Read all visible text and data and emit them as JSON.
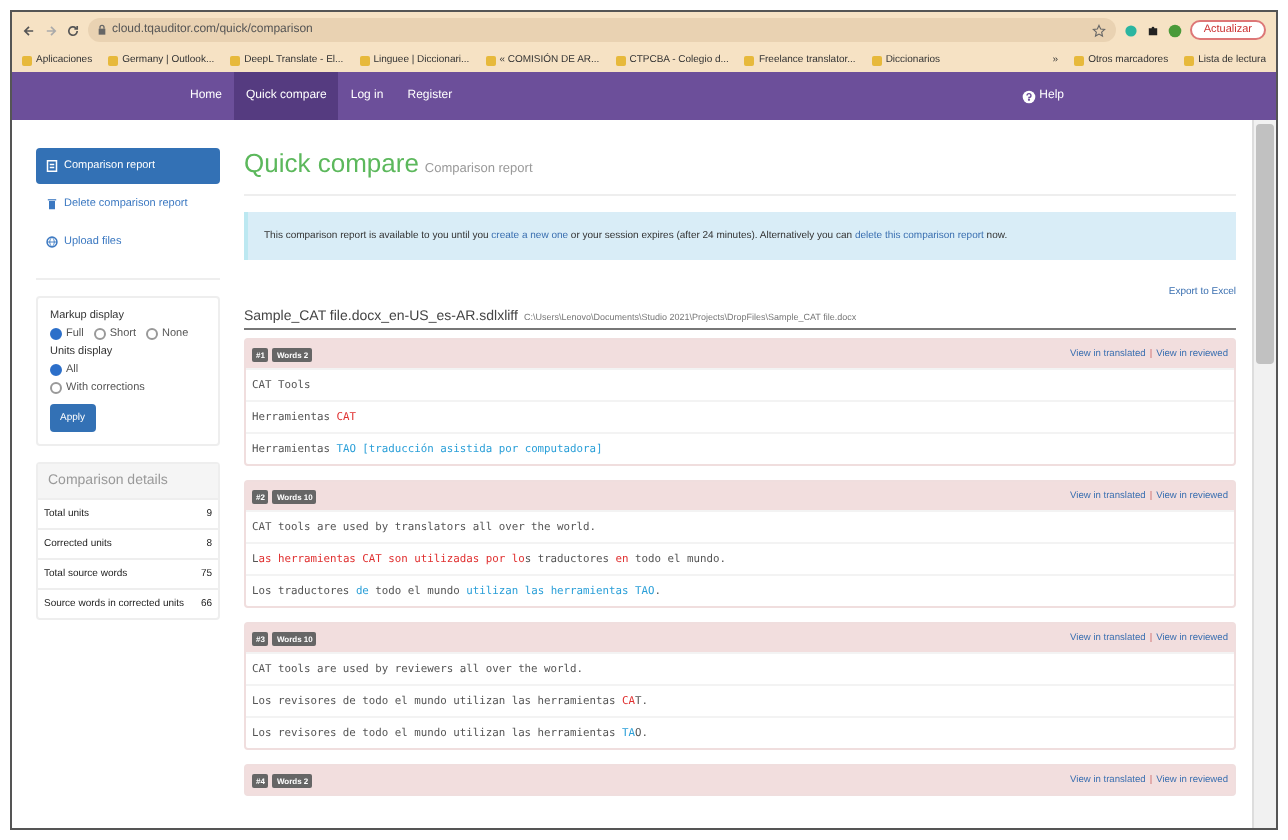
{
  "browser": {
    "url": "cloud.tqauditor.com/quick/comparison",
    "update_button": "Actualizar",
    "bookmarks": [
      "Aplicaciones",
      "Germany | Outlook...",
      "DeepL Translate - El...",
      "Linguee | Diccionari...",
      "« COMISIÓN DE AR...",
      "CTPCBA - Colegio d...",
      "Freelance translator...",
      "Diccionarios"
    ],
    "overflow": "»",
    "other_bookmarks": [
      "Otros marcadores",
      "Lista de lectura"
    ]
  },
  "nav": {
    "items": [
      {
        "label": "Home",
        "selected": false
      },
      {
        "label": "Quick compare",
        "selected": true
      },
      {
        "label": "Log in",
        "selected": false
      },
      {
        "label": "Register",
        "selected": false
      }
    ],
    "help": "Help"
  },
  "sidebar": {
    "items": [
      {
        "label": "Comparison report",
        "selected": true
      },
      {
        "label": "Delete comparison report",
        "selected": false
      },
      {
        "label": "Upload files",
        "selected": false
      }
    ],
    "markup_display": {
      "label": "Markup display",
      "options": [
        {
          "label": "Full",
          "selected": true
        },
        {
          "label": "Short",
          "selected": false
        },
        {
          "label": "None",
          "selected": false
        }
      ]
    },
    "units_display": {
      "label": "Units display",
      "options": [
        {
          "label": "All",
          "selected": true
        },
        {
          "label": "With corrections",
          "selected": false
        }
      ]
    },
    "apply": "Apply",
    "details": {
      "title": "Comparison details",
      "rows": [
        {
          "label": "Total units",
          "value": "9"
        },
        {
          "label": "Corrected units",
          "value": "8"
        },
        {
          "label": "Total source words",
          "value": "75"
        },
        {
          "label": "Source words in corrected units",
          "value": "66"
        }
      ]
    }
  },
  "heading": {
    "title": "Quick compare",
    "subtitle": "Comparison report"
  },
  "alert": [
    {
      "kind": "text",
      "text": "This comparison report is available to you until you "
    },
    {
      "kind": "link",
      "text": "create a new one"
    },
    {
      "kind": "text",
      "text": " or your session expires (after 24 minutes). Alternatively you can "
    },
    {
      "kind": "link",
      "text": "delete this comparison report"
    },
    {
      "kind": "text",
      "text": " now."
    }
  ],
  "export": "Export to Excel",
  "file": {
    "name": "Sample_CAT file.docx_en-US_es-AR.sdlxliff",
    "path": "C:\\Users\\Lenovo\\Documents\\Studio 2021\\Projects\\DropFiles\\Sample_CAT file.docx"
  },
  "units": [
    {
      "number": "#1",
      "words": "Words 2",
      "view_translated": "View in translated",
      "separator": "|",
      "view_reviewed": "View in reviewed",
      "lines": [
        [
          {
            "kind": "plain",
            "text": "CAT Tools"
          }
        ],
        [
          {
            "kind": "plain",
            "text": "Herramientas "
          },
          {
            "kind": "deleted",
            "text": "CAT"
          }
        ],
        [
          {
            "kind": "plain",
            "text": "Herramientas "
          },
          {
            "kind": "inserted",
            "text": "TAO [traducción asistida por computadora]"
          }
        ]
      ]
    },
    {
      "number": "#2",
      "words": "Words 10",
      "view_translated": "View in translated",
      "separator": "|",
      "view_reviewed": "View in reviewed",
      "lines": [
        [
          {
            "kind": "plain",
            "text": "CAT tools are used by translators all over the world."
          }
        ],
        [
          {
            "kind": "plain",
            "text": "L"
          },
          {
            "kind": "deleted",
            "text": "as herramientas CAT son utilizadas por lo"
          },
          {
            "kind": "plain",
            "text": "s traductores "
          },
          {
            "kind": "deleted",
            "text": "en"
          },
          {
            "kind": "plain",
            "text": " todo el mundo."
          }
        ],
        [
          {
            "kind": "plain",
            "text": "Los traductores "
          },
          {
            "kind": "inserted",
            "text": "de"
          },
          {
            "kind": "plain",
            "text": " todo el mundo "
          },
          {
            "kind": "inserted",
            "text": "utilizan las herramientas TAO"
          },
          {
            "kind": "plain",
            "text": "."
          }
        ]
      ]
    },
    {
      "number": "#3",
      "words": "Words 10",
      "view_translated": "View in translated",
      "separator": "|",
      "view_reviewed": "View in reviewed",
      "lines": [
        [
          {
            "kind": "plain",
            "text": "CAT tools are used by reviewers all over the world."
          }
        ],
        [
          {
            "kind": "plain",
            "text": "Los revisores de todo el mundo utilizan las herramientas "
          },
          {
            "kind": "deleted",
            "text": "CA"
          },
          {
            "kind": "plain",
            "text": "T."
          }
        ],
        [
          {
            "kind": "plain",
            "text": "Los revisores de todo el mundo utilizan las herramientas "
          },
          {
            "kind": "inserted",
            "text": "TA"
          },
          {
            "kind": "plain",
            "text": "O."
          }
        ]
      ]
    },
    {
      "number": "#4",
      "words": "Words 2",
      "view_translated": "View in translated",
      "separator": "|",
      "view_reviewed": "View in reviewed"
    }
  ]
}
